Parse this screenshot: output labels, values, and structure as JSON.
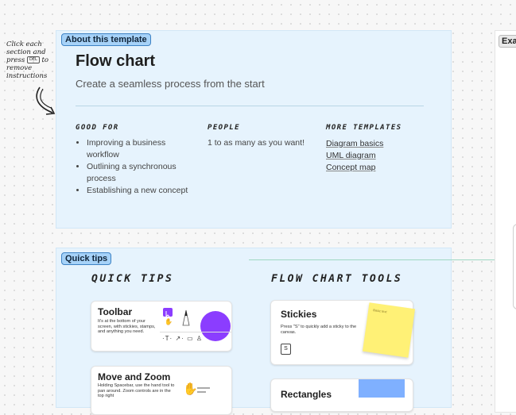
{
  "side_note": {
    "line1": "Click each section and press",
    "key": "DEL",
    "line2": "to remove instructions"
  },
  "about": {
    "chip": "About this template",
    "title": "Flow chart",
    "subtitle": "Create a seamless process from the start",
    "good_for_heading": "GOOD FOR",
    "good_for": [
      "Improving a business workflow",
      "Outlining a synchronous process",
      "Establishing a new concept"
    ],
    "people_heading": "PEOPLE",
    "people": "1 to as many as you want!",
    "more_heading": "MORE TEMPLATES",
    "more": [
      "Diagram basics",
      "UML diagram",
      "Concept map"
    ]
  },
  "tips": {
    "chip": "Quick tips",
    "quick_heading": "QUICK TIPS",
    "flow_heading": "FLOW CHART TOOLS",
    "toolbar_title": "Toolbar",
    "toolbar_desc": "It's at the bottom of your screen, with stickies, stamps, and anything you need.",
    "move_title": "Move and Zoom",
    "move_desc": "Holding Spacebar, use the hand tool to pan around. Zoom controls are in the top right",
    "stickies_title": "Stickies",
    "stickies_desc": "Press \"S\" to quickly add a sticky to the canvas.",
    "stickies_key": "S",
    "sticky_note_text": "Basic text",
    "rect_title": "Rectangles"
  },
  "right_panel": {
    "chip": "Exa"
  },
  "colors": {
    "section_bg": "#e6f3fd",
    "chip_blue": "#a6d2f8",
    "sticky_yellow": "#fff176",
    "rect_blue": "#7fb0ff",
    "purple": "#8b3dff"
  },
  "icons": [
    "curved-arrow-icon",
    "cursor-icon",
    "hand-icon",
    "pen-icon",
    "text-tool-icon",
    "connector-tool-icon",
    "frame-icon",
    "stamp-icon",
    "lines-icon"
  ]
}
